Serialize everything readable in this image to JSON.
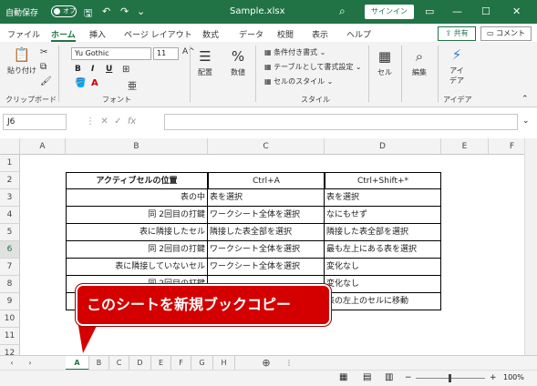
{
  "titlebar": {
    "autosave_label": "自動保存",
    "autosave_state": "オフ",
    "filename": "Sample.xlsx",
    "signin": "サインイン"
  },
  "menu": [
    "ファイル",
    "ホーム",
    "挿入",
    "ページ レイアウト",
    "数式",
    "データ",
    "校閲",
    "表示",
    "ヘルプ"
  ],
  "menu_active": "ホーム",
  "share_label": "共有",
  "comment_label": "コメント",
  "ribbon": {
    "paste": "貼り付け",
    "clipboard": "クリップボード",
    "font_name": "Yu Gothic",
    "font_size": "11",
    "font_group": "フォント",
    "align": "配置",
    "number": "数値",
    "cond_format": "条件付き書式",
    "table_format": "テーブルとして書式設定",
    "cell_style": "セルのスタイル",
    "style_group": "スタイル",
    "cells": "セル",
    "editing": "編集",
    "ideas_line1": "アイ",
    "ideas_line2": "デア",
    "ideas_group": "アイデア"
  },
  "namebox": "J6",
  "columns": [
    "A",
    "B",
    "C",
    "D",
    "E",
    "F"
  ],
  "rows": [
    "1",
    "2",
    "3",
    "4",
    "5",
    "6",
    "7",
    "8",
    "9",
    "10",
    "11",
    "12"
  ],
  "selected_row": "6",
  "table": {
    "header": [
      "アクティブセルの位置",
      "Ctrl+A",
      "Ctrl+Shift+*"
    ],
    "rows": [
      [
        "表の中",
        "表を選択",
        "表を選択"
      ],
      [
        "同 2回目の打鍵",
        "ワークシート全体を選択",
        "なにもせず"
      ],
      [
        "表に隣接したセル",
        "隣接した表全部を選択",
        "隣接した表全部を選択"
      ],
      [
        "同 2回目の打鍵",
        "ワークシート全体を選択",
        "最も左上にある表を選択"
      ],
      [
        "表に隣接していないセル",
        "ワークシート全体を選択",
        "変化なし"
      ],
      [
        "同 2回目の打鍵",
        "",
        "変化なし"
      ],
      [
        "",
        "",
        "表の左上のセルに移動"
      ]
    ]
  },
  "sheet_tabs": [
    "A",
    "B",
    "C",
    "D",
    "E",
    "F",
    "G",
    "H"
  ],
  "active_tab": "A",
  "zoom": "100%",
  "callout_text": "このシートを新規ブックコピー"
}
